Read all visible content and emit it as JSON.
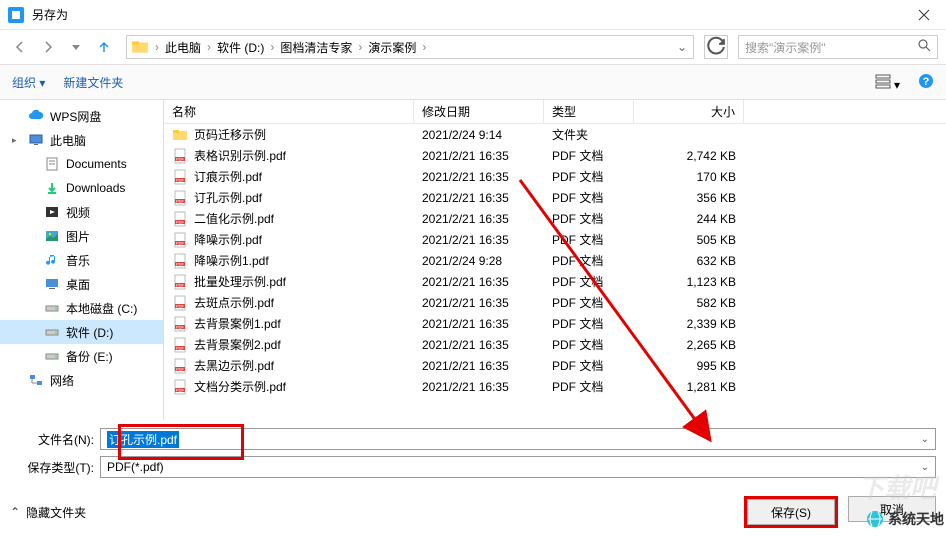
{
  "title": "另存为",
  "breadcrumb": [
    "此电脑",
    "软件 (D:)",
    "图档清洁专家",
    "演示案例"
  ],
  "search_placeholder": "搜索\"演示案例\"",
  "toolbar": {
    "organize": "组织 ▾",
    "new_folder": "新建文件夹"
  },
  "columns": {
    "name": "名称",
    "date": "修改日期",
    "type": "类型",
    "size": "大小"
  },
  "sidebar": [
    {
      "label": "WPS网盘",
      "icon": "cloud",
      "depth": 0,
      "selected": false
    },
    {
      "label": "此电脑",
      "icon": "pc",
      "depth": 0,
      "selected": false,
      "expandable": true
    },
    {
      "label": "Documents",
      "icon": "doc",
      "depth": 1,
      "selected": false
    },
    {
      "label": "Downloads",
      "icon": "down",
      "depth": 1,
      "selected": false
    },
    {
      "label": "视频",
      "icon": "video",
      "depth": 1,
      "selected": false
    },
    {
      "label": "图片",
      "icon": "pic",
      "depth": 1,
      "selected": false
    },
    {
      "label": "音乐",
      "icon": "music",
      "depth": 1,
      "selected": false
    },
    {
      "label": "桌面",
      "icon": "desktop",
      "depth": 1,
      "selected": false
    },
    {
      "label": "本地磁盘 (C:)",
      "icon": "drive",
      "depth": 1,
      "selected": false
    },
    {
      "label": "软件 (D:)",
      "icon": "drive",
      "depth": 1,
      "selected": true
    },
    {
      "label": "备份 (E:)",
      "icon": "drive",
      "depth": 1,
      "selected": false
    },
    {
      "label": "网络",
      "icon": "net",
      "depth": 0,
      "selected": false
    }
  ],
  "files": [
    {
      "name": "页码迁移示例",
      "date": "2021/2/24 9:14",
      "type": "文件夹",
      "size": "",
      "icon": "folder"
    },
    {
      "name": "表格识别示例.pdf",
      "date": "2021/2/21 16:35",
      "type": "PDF 文档",
      "size": "2,742 KB",
      "icon": "pdf"
    },
    {
      "name": "订痕示例.pdf",
      "date": "2021/2/21 16:35",
      "type": "PDF 文档",
      "size": "170 KB",
      "icon": "pdf"
    },
    {
      "name": "订孔示例.pdf",
      "date": "2021/2/21 16:35",
      "type": "PDF 文档",
      "size": "356 KB",
      "icon": "pdf"
    },
    {
      "name": "二值化示例.pdf",
      "date": "2021/2/21 16:35",
      "type": "PDF 文档",
      "size": "244 KB",
      "icon": "pdf"
    },
    {
      "name": "降噪示例.pdf",
      "date": "2021/2/21 16:35",
      "type": "PDF 文档",
      "size": "505 KB",
      "icon": "pdf"
    },
    {
      "name": "降噪示例1.pdf",
      "date": "2021/2/24 9:28",
      "type": "PDF 文档",
      "size": "632 KB",
      "icon": "pdf"
    },
    {
      "name": "批量处理示例.pdf",
      "date": "2021/2/21 16:35",
      "type": "PDF 文档",
      "size": "1,123 KB",
      "icon": "pdf"
    },
    {
      "name": "去斑点示例.pdf",
      "date": "2021/2/21 16:35",
      "type": "PDF 文档",
      "size": "582 KB",
      "icon": "pdf"
    },
    {
      "name": "去背景案例1.pdf",
      "date": "2021/2/21 16:35",
      "type": "PDF 文档",
      "size": "2,339 KB",
      "icon": "pdf"
    },
    {
      "name": "去背景案例2.pdf",
      "date": "2021/2/21 16:35",
      "type": "PDF 文档",
      "size": "2,265 KB",
      "icon": "pdf"
    },
    {
      "name": "去黑边示例.pdf",
      "date": "2021/2/21 16:35",
      "type": "PDF 文档",
      "size": "995 KB",
      "icon": "pdf"
    },
    {
      "name": "文档分类示例.pdf",
      "date": "2021/2/21 16:35",
      "type": "PDF 文档",
      "size": "1,281 KB",
      "icon": "pdf"
    }
  ],
  "form": {
    "filename_label": "文件名(N):",
    "filename_value": "订孔示例.pdf",
    "type_label": "保存类型(T):",
    "type_value": "PDF(*.pdf)"
  },
  "bottom": {
    "hide_folders": "隐藏文件夹",
    "save": "保存(S)",
    "cancel": "取消"
  },
  "watermark": "系统天地"
}
